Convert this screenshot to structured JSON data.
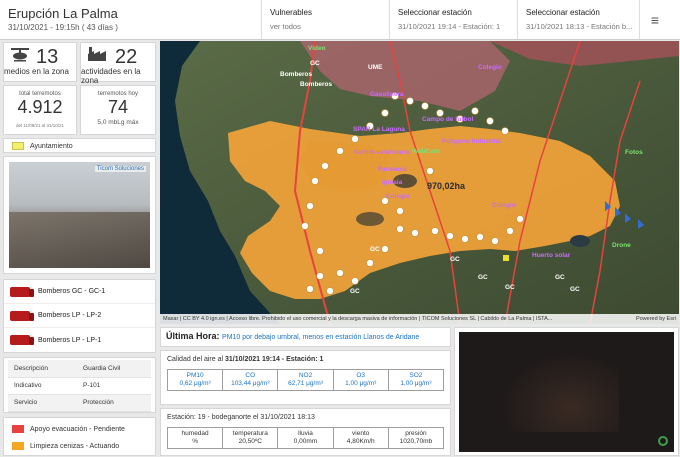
{
  "header": {
    "title": "Erupción La Palma",
    "subtitle": "31/10/2021 - 19:15h ( 43 días )",
    "vulnerables_label": "Vulnerables",
    "vulnerables_value": "ver todos",
    "station1_label": "Seleccionar estación",
    "station1_value": "31/10/2021 19:14 - Estación: 1",
    "station2_label": "Seleccionar estación",
    "station2_value": "31/10/2021 18:13 - Estación b...",
    "menu_icon": "≡"
  },
  "stats": {
    "medios": "13",
    "medios_label": "medios en la zona",
    "actividades": "22",
    "actividades_label": "actividades en la zona",
    "total_label": "total terremotos",
    "total_value": "4.912",
    "total_range": "del 11/09/21 al 31/10/21",
    "hoy_label": "terremotos hoy",
    "hoy_value": "74",
    "hoy_mag": "5,0 mbLg máx"
  },
  "legend": {
    "ayuntamiento": "Ayuntamiento",
    "webcam_brand": "Ticom Soluciones",
    "apoyo": "Apoyo evacuación - Pendiente",
    "limpieza": "Limpieza cenizas - Actuando"
  },
  "vehicles": [
    "Bomberos GC - GC-1",
    "Bomberos LP - LP-2",
    "Bomberos LP - LP-1"
  ],
  "details": [
    {
      "k": "Descripción",
      "v": "Guardia Civil"
    },
    {
      "k": "Indicativo",
      "v": "P-101"
    },
    {
      "k": "Servicio",
      "v": "Protección"
    }
  ],
  "map": {
    "area": "970,02ha",
    "attribution": "Maxar | CC BY 4.0 ign.es | Acceso libre. Prohibido el uso comercial y la descarga masiva de información | TICOM Soluciones SL | Cabildo de La Palma | ISTA...",
    "powered": "Powered by Esri",
    "labels": {
      "bomberos1": "Bomberos",
      "bomberos2": "Bomberos",
      "video": "Video",
      "gc1": "GC",
      "ume": "UME",
      "gasolinera": "Gasolinera",
      "colegio1": "Colegio",
      "spar": "SPAR La Laguna",
      "campo": "Campo de fútbol",
      "poligono": "Polígono Industrial",
      "centro": "Centro veterinario",
      "webcam": "WebCam",
      "farmacia": "Farmacia",
      "iglesia": "Iglesia",
      "colegio2": "Colegio",
      "colegio3": "Colegio",
      "fotos": "Fotos",
      "drone": "Drone",
      "huerto": "Huerto solar",
      "gc2": "GC",
      "gc3": "GC",
      "gc4": "GC",
      "gc5": "GC",
      "gc6": "GC",
      "gc7": "GC",
      "gc8": "GC"
    }
  },
  "ultima": {
    "label": "Última Hora:",
    "message": "PM10 por debajo umbral, menos en estación Llanos de Aridane"
  },
  "calidad": {
    "title_prefix": "Calidad del aire al ",
    "title_bold": "31/10/2021 19:14 - Estación: 1",
    "items": [
      {
        "name": "PM10",
        "value": "0,62 μg/m³"
      },
      {
        "name": "CO",
        "value": "103,44 μg/m³"
      },
      {
        "name": "NO2",
        "value": "62,71 μg/m³"
      },
      {
        "name": "O3",
        "value": "1,00 μg/m³"
      },
      {
        "name": "SO2",
        "value": "1,00 μg/m³"
      }
    ]
  },
  "estacion": {
    "title": "Estación: 19 - bodeganorte el 31/10/2021 18:13",
    "items": [
      {
        "name": "humedad",
        "value": "%"
      },
      {
        "name": "temperatura",
        "value": "20,50ºC"
      },
      {
        "name": "lluvia",
        "value": "0,00mm"
      },
      {
        "name": "viento",
        "value": "4,80Km/h"
      },
      {
        "name": "presión",
        "value": "1020,70mb"
      }
    ]
  },
  "colors": {
    "lava": "#f2a33a",
    "road": "#e8423e",
    "danger": "#c1272d",
    "apoyo": "#e8423e",
    "limpieza": "#f5a623",
    "ayuntamiento": "#f2ef6d"
  }
}
